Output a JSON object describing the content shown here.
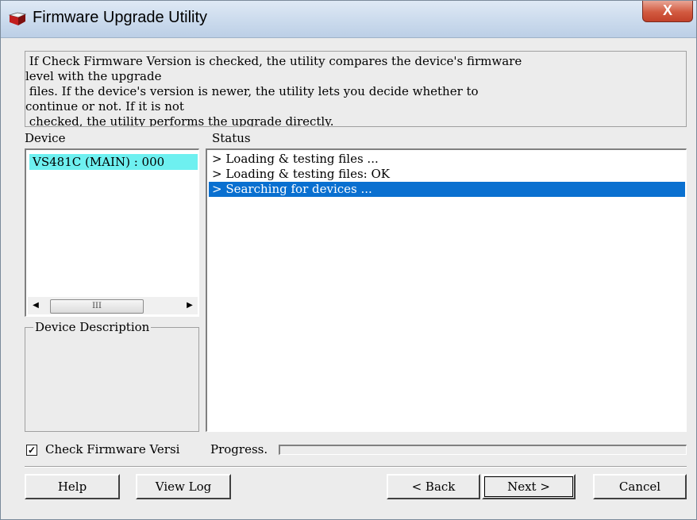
{
  "window": {
    "title": "Firmware Upgrade Utility",
    "close_label": "X"
  },
  "description_text": " If Check Firmware Version is checked, the utility compares the device's firmware\nlevel with the upgrade\n files. If the device's version is newer, the utility lets you decide whether to\ncontinue or not. If it is not\n checked, the utility performs the upgrade directly.",
  "device_panel": {
    "label": "Device",
    "items": [
      "VS481C (MAIN) : 000"
    ],
    "scroll_thumb_glyph": "III"
  },
  "device_description": {
    "label": "Device Description"
  },
  "status_panel": {
    "label": "Status",
    "lines": [
      "> Loading & testing files ...",
      "> Loading & testing files: OK",
      "> Searching for devices ..."
    ]
  },
  "check_firmware": {
    "label": "Check Firmware Versi",
    "checked": true
  },
  "progress": {
    "label": "Progress.",
    "value": 0
  },
  "buttons": {
    "help": "Help",
    "view_log": "View Log",
    "back": "< Back",
    "next": "Next >",
    "cancel": "Cancel"
  },
  "colors": {
    "selected_device_bg": "#6ef0f0",
    "selected_status_bg": "#0a70d0",
    "close_button": "#d25a40"
  }
}
